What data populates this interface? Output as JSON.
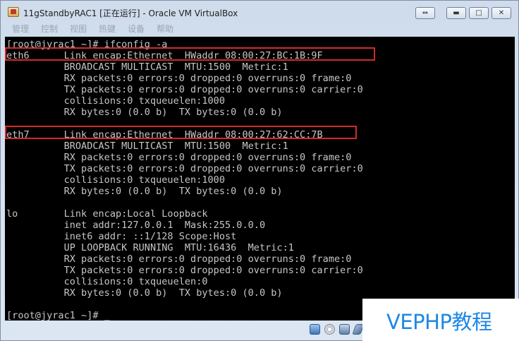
{
  "window": {
    "title": "11gStandbyRAC1 [正在运行] - Oracle VM VirtualBox",
    "controls": {
      "restore_down": "⇔",
      "minimize": "▬",
      "maximize": "□",
      "close": "✕"
    }
  },
  "menu": {
    "items": [
      {
        "label": "管理"
      },
      {
        "label": "控制"
      },
      {
        "label": "视图"
      },
      {
        "label": "热键"
      },
      {
        "label": "设备"
      },
      {
        "label": "帮助"
      }
    ]
  },
  "terminal": {
    "lines": [
      "[root@jyrac1 ~]# ifconfig -a",
      "eth6      Link encap:Ethernet  HWaddr 08:00:27:BC:1B:9F",
      "          BROADCAST MULTICAST  MTU:1500  Metric:1",
      "          RX packets:0 errors:0 dropped:0 overruns:0 frame:0",
      "          TX packets:0 errors:0 dropped:0 overruns:0 carrier:0",
      "          collisions:0 txqueuelen:1000",
      "          RX bytes:0 (0.0 b)  TX bytes:0 (0.0 b)",
      "",
      "eth7      Link encap:Ethernet  HWaddr 08:00:27:62:CC:7B",
      "          BROADCAST MULTICAST  MTU:1500  Metric:1",
      "          RX packets:0 errors:0 dropped:0 overruns:0 frame:0",
      "          TX packets:0 errors:0 dropped:0 overruns:0 carrier:0",
      "          collisions:0 txqueuelen:1000",
      "          RX bytes:0 (0.0 b)  TX bytes:0 (0.0 b)",
      "",
      "lo        Link encap:Local Loopback",
      "          inet addr:127.0.0.1  Mask:255.0.0.0",
      "          inet6 addr: ::1/128 Scope:Host",
      "          UP LOOPBACK RUNNING  MTU:16436  Metric:1",
      "          RX packets:0 errors:0 dropped:0 overruns:0 frame:0",
      "          TX packets:0 errors:0 dropped:0 overruns:0 carrier:0",
      "          collisions:0 txqueuelen:0",
      "          RX bytes:0 (0.0 b)  TX bytes:0 (0.0 b)",
      "",
      "[root@jyrac1 ~]# _"
    ]
  },
  "statusbar": {
    "icons": [
      "hard-disk-icon",
      "optical-drive-icon",
      "network-icon",
      "usb-icon"
    ]
  },
  "watermark": {
    "text": "VEPHP教程"
  },
  "colors": {
    "highlight": "#d42a2a",
    "console_bg": "#000000",
    "console_fg": "#c6c6c6",
    "watermark": "#1e88e5"
  }
}
